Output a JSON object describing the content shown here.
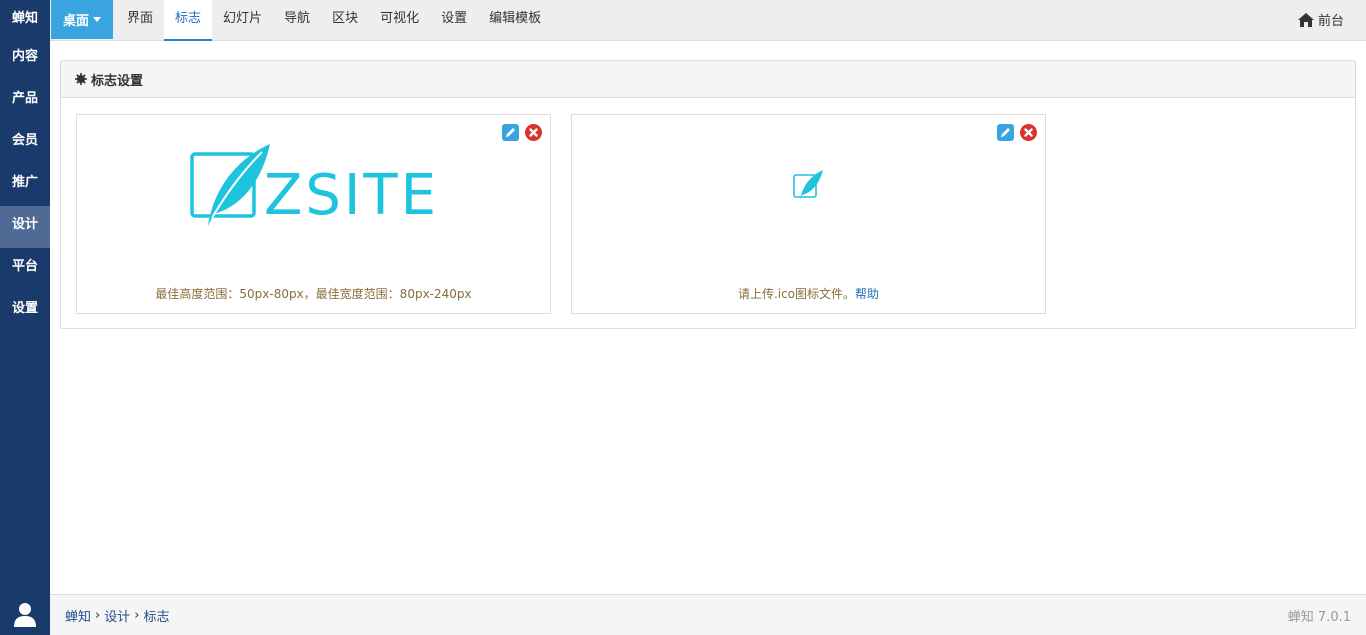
{
  "sidebar": {
    "brand": "蝉知",
    "items": [
      {
        "label": "内容"
      },
      {
        "label": "产品"
      },
      {
        "label": "会员"
      },
      {
        "label": "推广"
      },
      {
        "label": "设计"
      },
      {
        "label": "平台"
      },
      {
        "label": "设置"
      }
    ],
    "active_index": 4
  },
  "topnav": {
    "desktop_label": "桌面",
    "tabs": [
      {
        "label": "界面"
      },
      {
        "label": "标志"
      },
      {
        "label": "幻灯片"
      },
      {
        "label": "导航"
      },
      {
        "label": "区块"
      },
      {
        "label": "可视化"
      },
      {
        "label": "设置"
      },
      {
        "label": "编辑模板"
      }
    ],
    "active_tab": 1,
    "front_label": "前台"
  },
  "panel": {
    "title": "标志设置",
    "logo_card": {
      "logo_text": "ZSITE",
      "caption": "最佳高度范围：50px-80px，最佳宽度范围：80px-240px"
    },
    "favicon_card": {
      "caption": "请上传.ico图标文件。",
      "help_link": "帮助"
    }
  },
  "footer": {
    "breadcrumb": [
      "蝉知",
      "设计",
      "标志"
    ],
    "version": "蝉知 7.0.1"
  },
  "colors": {
    "sidebar_bg": "#1a3a6c",
    "sidebar_active": "#4f6a93",
    "accent": "#3aa4e0",
    "logo_teal": "#1ec3dd",
    "delete_red": "#d9342b",
    "caption_brown": "#8a6d3b"
  }
}
